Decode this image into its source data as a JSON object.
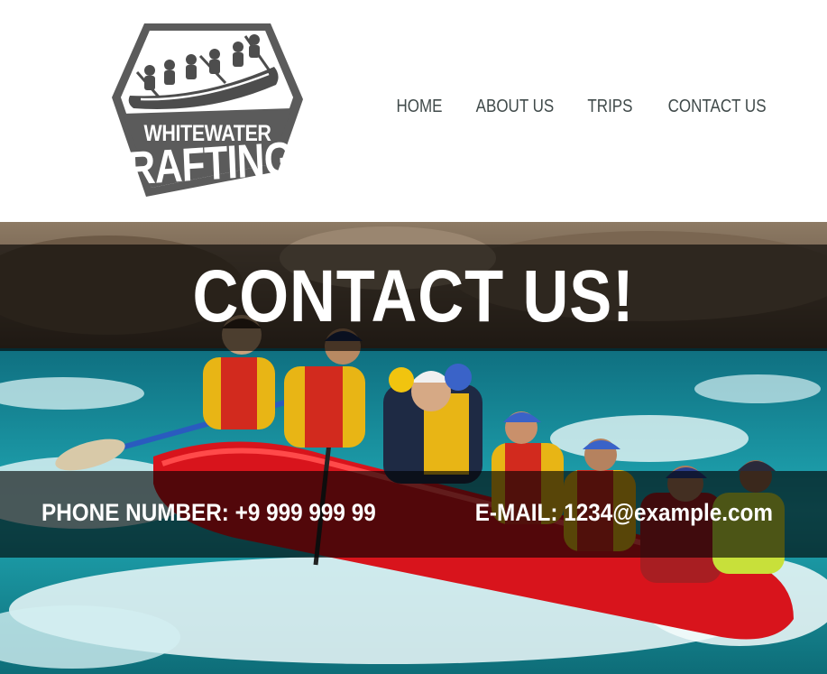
{
  "brand": {
    "logo_line1": "WHITEWATER",
    "logo_line2": "RAFTING"
  },
  "nav": {
    "items": [
      "HOME",
      "ABOUT US",
      "TRIPS",
      "CONTACT US"
    ]
  },
  "hero": {
    "title": "CONTACT US!",
    "phone": "PHONE NUMBER: +9 999 999 99",
    "email": "E-MAIL: 1234@example.com"
  },
  "colors": {
    "nav_text": "#404a4a",
    "logo_gray": "#5a5a5a",
    "overlay": "rgba(0,0,0,0.62)",
    "water": "#1ea6b0",
    "raft": "#d8141c"
  }
}
